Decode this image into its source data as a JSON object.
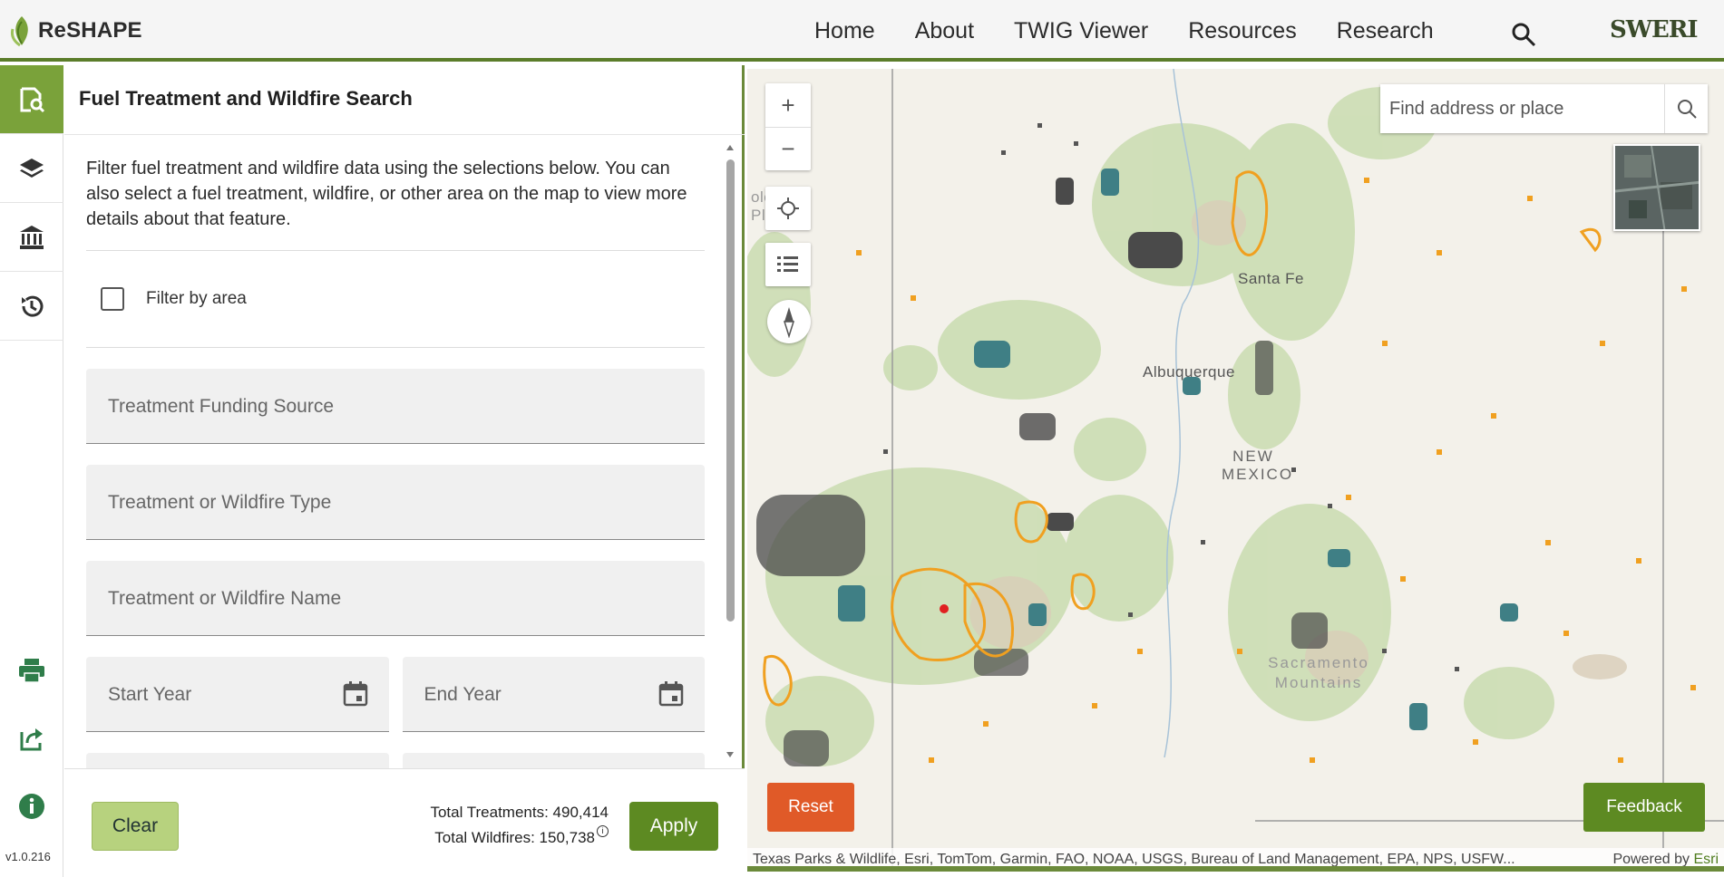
{
  "header": {
    "logo_text": "ReSHAPE",
    "nav": [
      "Home",
      "About",
      "TWIG Viewer",
      "Resources",
      "Research"
    ],
    "partner_logo": "SWERI"
  },
  "rail": {
    "items": [
      "search-panel-icon",
      "layers-icon",
      "institution-icon",
      "history-icon"
    ],
    "bottom": [
      "print-icon",
      "share-icon",
      "info-icon"
    ],
    "version": "v1.0.216"
  },
  "panel": {
    "title": "Fuel Treatment and Wildfire Search",
    "intro": "Filter fuel treatment and wildfire data using the selections below. You can also select a fuel treatment, wildfire, or other area on the map to view more details about that feature.",
    "filter_by_area": "Filter by area",
    "fields": {
      "funding_source": "Treatment Funding Source",
      "type": "Treatment or Wildfire Type",
      "name": "Treatment or Wildfire Name",
      "start_year": "Start Year",
      "end_year": "End Year"
    },
    "footer": {
      "clear": "Clear",
      "total_treatments": "Total Treatments: 490,414",
      "total_wildfires": "Total Wildfires: 150,738",
      "apply": "Apply"
    }
  },
  "map": {
    "search_placeholder": "Find address or place",
    "labels": {
      "santa_fe": "Santa Fe",
      "albuquerque": "Albuquerque",
      "state_line1": "NEW",
      "state_line2": "MEXICO",
      "mountains_line1": "Sacramento",
      "mountains_line2": "Mountains",
      "colorado_line1": "olorado",
      "colorado_line2": "Plateau"
    },
    "reset": "Reset",
    "feedback": "Feedback",
    "attribution": "Texas Parks & Wildlife, Esri, TomTom, Garmin, FAO, NOAA, USGS, Bureau of Land Management, EPA, NPS, USFW...",
    "powered_by": "Powered by",
    "esri": "Esri",
    "colors": {
      "treatment": "#f0a020",
      "wildfire": "#4a4a4a",
      "teal": "#3f7f85",
      "forest": "#c9dcb0"
    }
  }
}
